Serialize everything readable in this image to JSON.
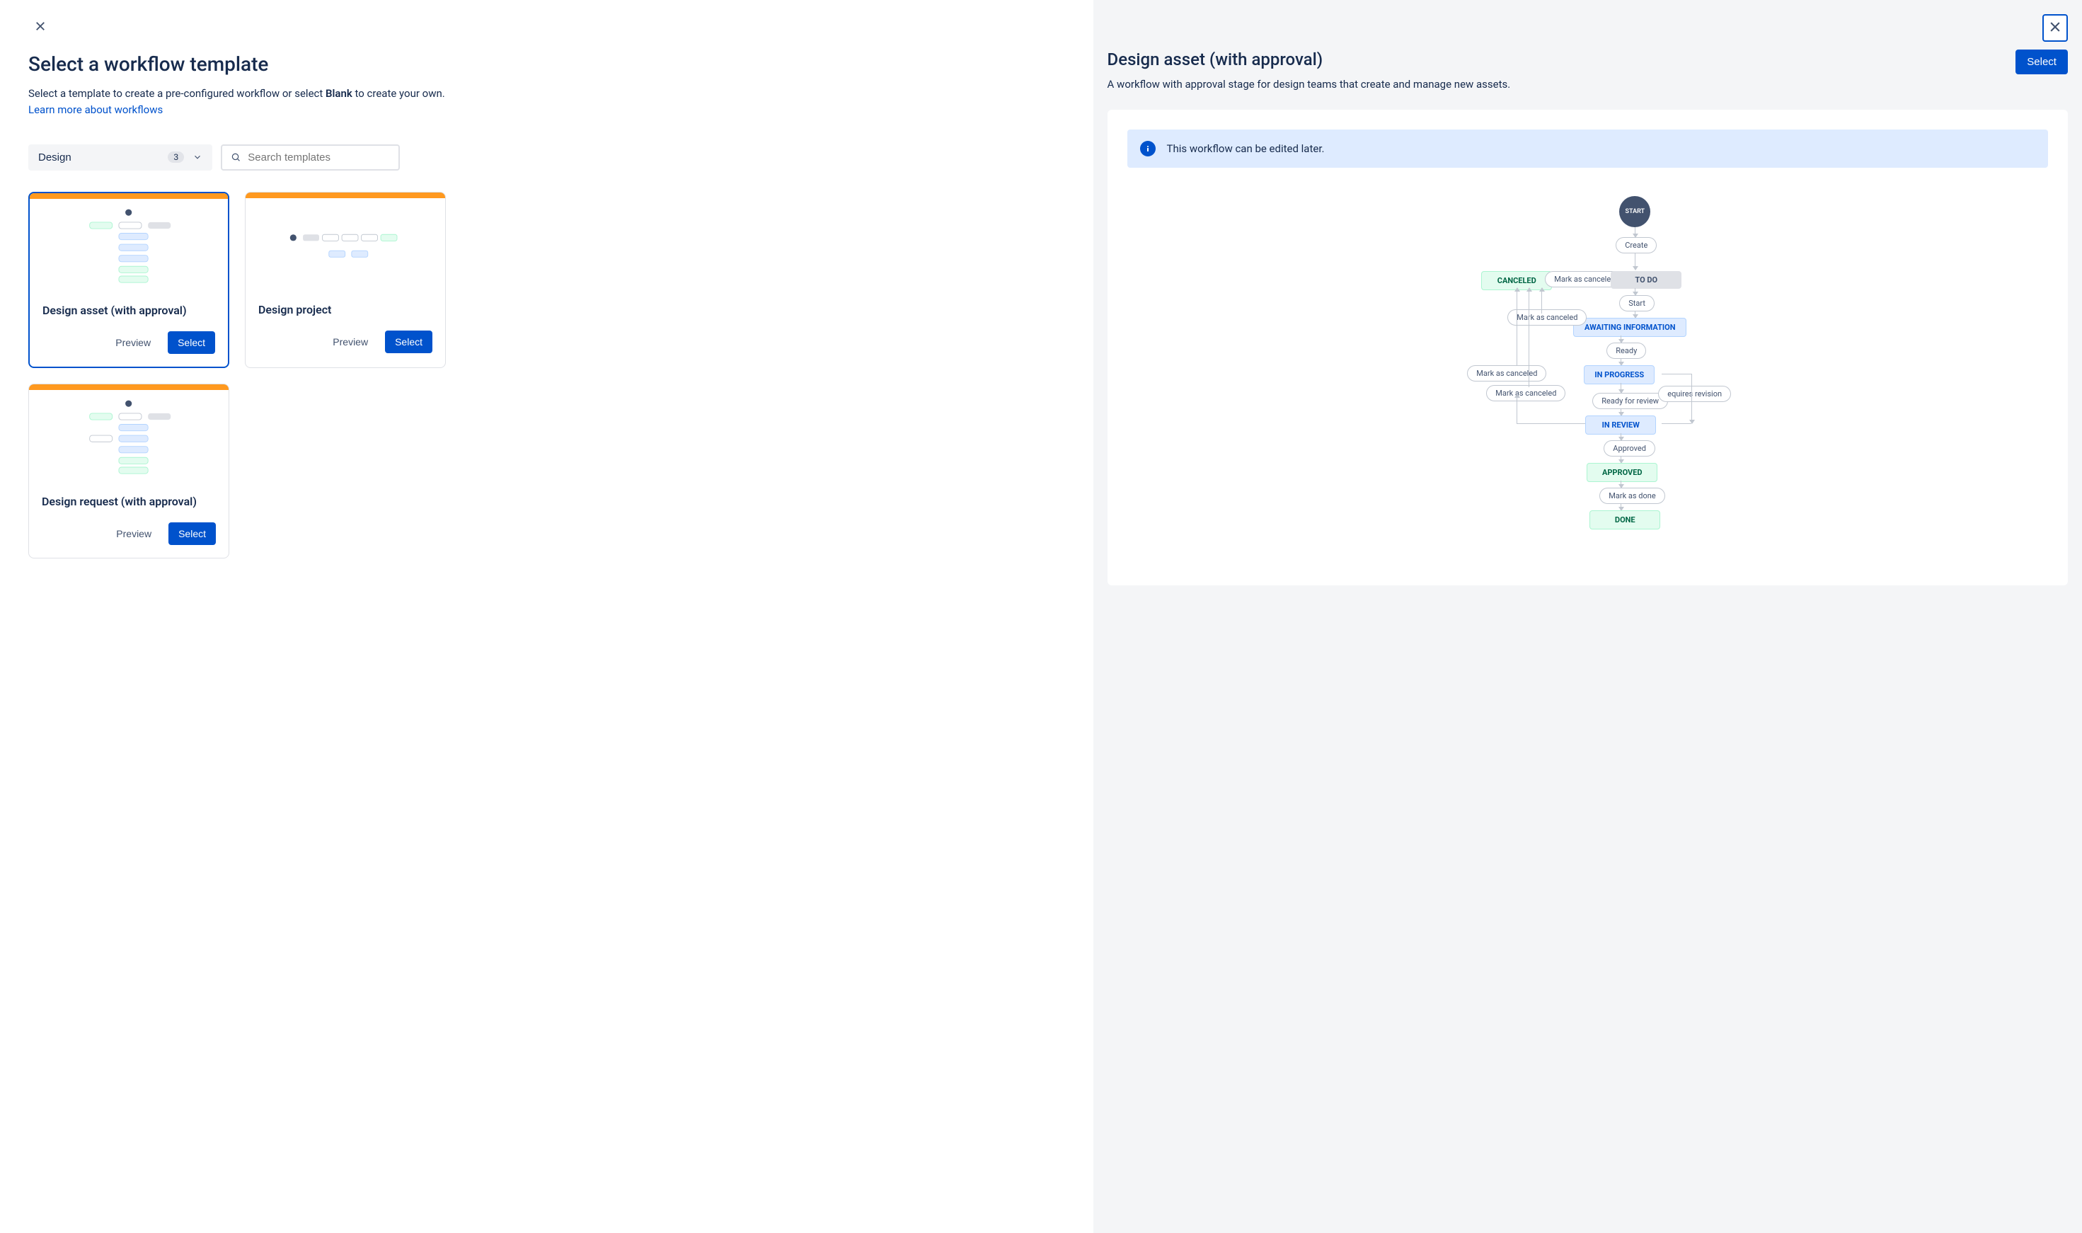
{
  "left": {
    "title": "Select a workflow template",
    "desc_prefix": "Select a template to create a pre-configured workflow or select ",
    "desc_blank": "Blank",
    "desc_suffix": " to create your own.",
    "learn_more": "Learn more about workflows",
    "category": {
      "label": "Design",
      "count": "3"
    },
    "search_placeholder": "Search templates"
  },
  "cards": [
    {
      "title": "Design asset (with approval)",
      "preview": "Preview",
      "select": "Select",
      "selected": true
    },
    {
      "title": "Design project",
      "preview": "Preview",
      "select": "Select",
      "selected": false
    },
    {
      "title": "Design request (with approval)",
      "preview": "Preview",
      "select": "Select",
      "selected": false
    }
  ],
  "right": {
    "title": "Design asset (with approval)",
    "desc": "A workflow with approval stage for design teams that create and manage new assets.",
    "select_label": "Select",
    "info_text": "This workflow can be edited later."
  },
  "wf": {
    "start": "START",
    "create": "Create",
    "canceled": "CANCELED",
    "mark_canceled": "Mark as canceled",
    "todo": "TO DO",
    "start_trans": "Start",
    "awaiting": "AWAITING INFORMATION",
    "ready": "Ready",
    "in_progress": "IN PROGRESS",
    "ready_review": "Ready for review",
    "requires_revision": "equires revision",
    "in_review": "IN REVIEW",
    "approved_trans": "Approved",
    "approved": "APPROVED",
    "mark_done": "Mark as done",
    "done": "DONE"
  }
}
